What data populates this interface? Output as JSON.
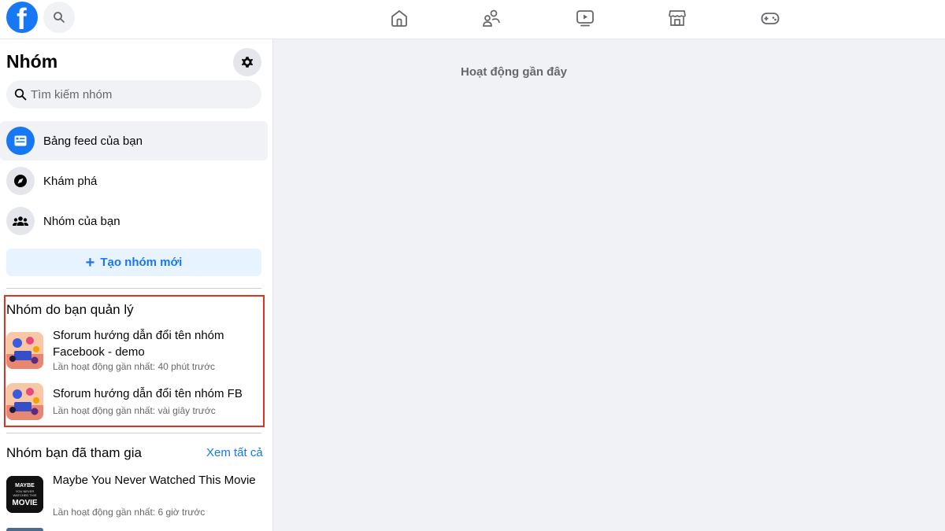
{
  "header": {
    "logo_letter": "f",
    "icons": [
      "search-icon",
      "home-icon",
      "friends-icon",
      "watch-icon",
      "marketplace-icon",
      "gaming-icon"
    ]
  },
  "sidebar": {
    "title": "Nhóm",
    "search_placeholder": "Tìm kiếm nhóm",
    "nav_items": [
      {
        "label": "Bảng feed của bạn",
        "icon": "feed-icon"
      },
      {
        "label": "Khám phá",
        "icon": "compass-icon"
      },
      {
        "label": "Nhóm của bạn",
        "icon": "groups-icon"
      }
    ],
    "create_button_label": "Tạo nhóm mới",
    "managed_section": {
      "title": "Nhóm do bạn quản lý",
      "groups": [
        {
          "name": "Sforum hướng dẫn đổi tên nhóm Facebook - demo",
          "meta": "Lần hoạt động gần nhất: 40 phút trước"
        },
        {
          "name": "Sforum hướng dẫn đổi tên nhóm FB",
          "meta": "Lần hoạt động gần nhất: vài giây trước"
        }
      ]
    },
    "joined_section": {
      "title": "Nhóm bạn đã tham gia",
      "see_all": "Xem tất cả",
      "groups": [
        {
          "name": "Maybe You Never Watched This Movie",
          "meta": "Lần hoạt động gần nhất: 6 giờ trước",
          "thumb_text": "MAYBE YOU NEVER WATCHED THIS MOVIE"
        }
      ]
    }
  },
  "main": {
    "heading": "Hoạt động gần đây"
  },
  "colors": {
    "brand": "#1877f2",
    "highlight_border": "#e03220",
    "page_bg": "#f0f2f5"
  }
}
